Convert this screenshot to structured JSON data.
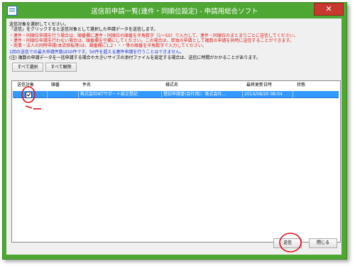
{
  "window": {
    "title": "送信前申請一覧(連件・同順位設定) - 申請用総合ソフト",
    "close_glyph": "✕"
  },
  "instructions": {
    "line1": "送信対象を選択してください。",
    "line2": "「送信」をクリックすると送信対象として選択した申請データを送信します。",
    "red1": "・連件・同順位申請を行う場合は、順番欄に連件・同順位の順番を半角数字（1～50）で入力して、連件・同順位のまとまりごとに送信してください。",
    "red2": "・連件・同順位申請を行わない場合は、順番欄を空欄にしてください。この場合は、単独の申請として複数の申請を同時に送信することができます。",
    "red3": "・商業・法人の同時申請(本店移転等)は、順番欄に1,2・・・等の順番を半角数字で入力してください。",
    "blue1": "1回の送信での最大申請件数は50件です。50件を超える連件申請を行うことはできません。",
    "note": "(注) 複数の申請データを一括申請する場合や大きいサイズの添付ファイルを設定する場合は、送信に時間がかかることがあります。"
  },
  "buttons": {
    "select_all": "すべて選択",
    "deselect_all": "すべて解除",
    "send": "送信",
    "close": "閉じる"
  },
  "table": {
    "headers": [
      "送信対象",
      "順番",
      "件名",
      "様式名",
      "最終更新日時",
      "状態"
    ],
    "rows": [
      {
        "checked": true,
        "order": "",
        "subject": "株式会社IKTサポート設立登記",
        "form_name": "登記申請書(会社用)：株式会社...",
        "updated": "2014/08/20 08:04",
        "status": ""
      }
    ]
  },
  "colors": {
    "titlebar": "#4ea733",
    "selection": "#3399ff",
    "warning_text": "#e11b1b",
    "info_text": "#1631d8",
    "annotation": "#e0101a"
  }
}
